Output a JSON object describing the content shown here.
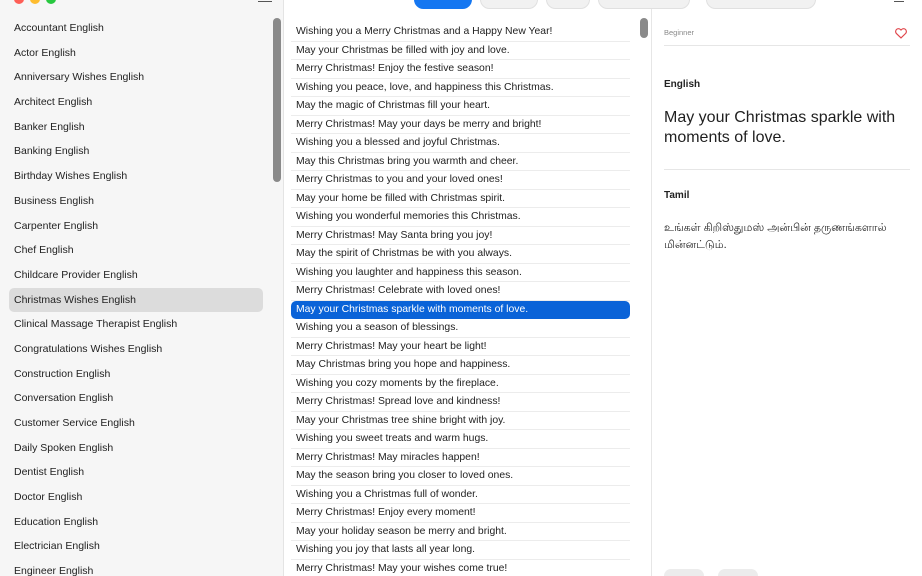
{
  "sidebar": {
    "items": [
      {
        "label": "Accountant English"
      },
      {
        "label": "Actor English"
      },
      {
        "label": "Anniversary Wishes English"
      },
      {
        "label": "Architect English"
      },
      {
        "label": "Banker English"
      },
      {
        "label": "Banking English"
      },
      {
        "label": "Birthday Wishes English"
      },
      {
        "label": "Business English"
      },
      {
        "label": "Carpenter English"
      },
      {
        "label": "Chef English"
      },
      {
        "label": "Childcare Provider English"
      },
      {
        "label": "Christmas Wishes English",
        "selected": true
      },
      {
        "label": "Clinical Massage Therapist English"
      },
      {
        "label": "Congratulations Wishes English"
      },
      {
        "label": "Construction English"
      },
      {
        "label": "Conversation English"
      },
      {
        "label": "Customer Service English"
      },
      {
        "label": "Daily Spoken English"
      },
      {
        "label": "Dentist English"
      },
      {
        "label": "Doctor English"
      },
      {
        "label": "Education English"
      },
      {
        "label": "Electrician English"
      },
      {
        "label": "Engineer English"
      }
    ]
  },
  "phrases": {
    "items": [
      {
        "text": "Wishing you a Merry Christmas and a Happy New Year!"
      },
      {
        "text": "May your Christmas be filled with joy and love."
      },
      {
        "text": "Merry Christmas! Enjoy the festive season!"
      },
      {
        "text": "Wishing you peace, love, and happiness this Christmas."
      },
      {
        "text": "May the magic of Christmas fill your heart."
      },
      {
        "text": "Merry Christmas! May your days be merry and bright!"
      },
      {
        "text": "Wishing you a blessed and joyful Christmas."
      },
      {
        "text": "May this Christmas bring you warmth and cheer."
      },
      {
        "text": "Merry Christmas to you and your loved ones!"
      },
      {
        "text": "May your home be filled with Christmas spirit."
      },
      {
        "text": "Wishing you wonderful memories this Christmas."
      },
      {
        "text": "Merry Christmas! May Santa bring you joy!"
      },
      {
        "text": "May the spirit of Christmas be with you always."
      },
      {
        "text": "Wishing you laughter and happiness this season."
      },
      {
        "text": "Merry Christmas! Celebrate with loved ones!"
      },
      {
        "text": "May your Christmas sparkle with moments of love.",
        "selected": true
      },
      {
        "text": "Wishing you a season of blessings."
      },
      {
        "text": "Merry Christmas! May your heart be light!"
      },
      {
        "text": "May Christmas bring you hope and happiness."
      },
      {
        "text": "Wishing you cozy moments by the fireplace."
      },
      {
        "text": "Merry Christmas! Spread love and kindness!"
      },
      {
        "text": "May your Christmas tree shine bright with joy."
      },
      {
        "text": "Wishing you sweet treats and warm hugs."
      },
      {
        "text": "Merry Christmas! May miracles happen!"
      },
      {
        "text": "May the season bring you closer to loved ones."
      },
      {
        "text": "Wishing you a Christmas full of wonder."
      },
      {
        "text": "Merry Christmas! Enjoy every moment!"
      },
      {
        "text": "May your holiday season be merry and bright."
      },
      {
        "text": "Wishing you joy that lasts all year long."
      },
      {
        "text": "Merry Christmas! May your wishes come true!"
      }
    ]
  },
  "detail": {
    "level": "Beginner",
    "english_label": "English",
    "english_text": "May your Christmas sparkle with moments of love.",
    "tamil_label": "Tamil",
    "tamil_text": "உங்கள் கிறிஸ்துமஸ் அன்பின் தருணங்களால் மின்னட்டும்.",
    "heart_icon": "heart-icon",
    "accent_color": "#0a63d8",
    "heart_color": "#e0454a"
  }
}
